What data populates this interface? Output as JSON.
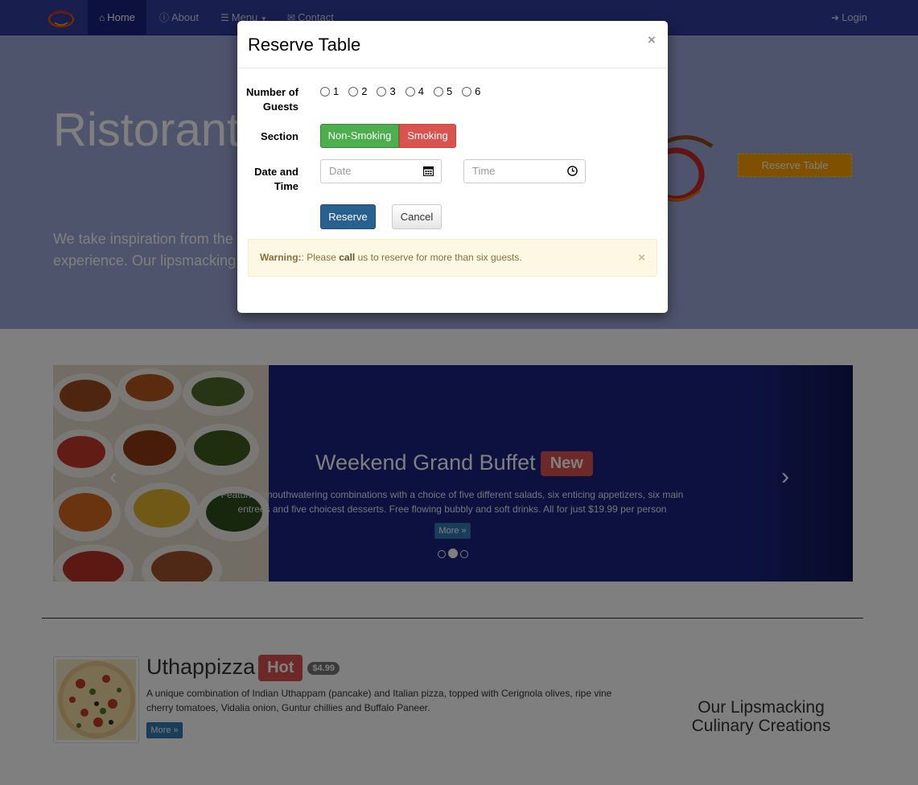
{
  "navbar": {
    "items": [
      {
        "label": "Home",
        "icon": "home-icon",
        "active": true
      },
      {
        "label": "About",
        "icon": "info-circle-icon"
      },
      {
        "label": "Menu",
        "icon": "list-icon",
        "dropdown": true
      },
      {
        "label": "Contact",
        "icon": "envelope-icon"
      }
    ],
    "login": "Login"
  },
  "jumbotron": {
    "title": "Ristorante",
    "text": "We take inspiration from the\nexperience. Our lipsmacking",
    "button": "Reserve Table"
  },
  "carousel": {
    "title": "Weekend Grand Buffet",
    "badge": "New",
    "text": "Featuring mouthwatering combinations with a choice of five different salads, six enticing appetizers, six main entrees and five choicest desserts. Free flowing bubbly and soft drinks. All for just $19.99 per person",
    "more": "More »",
    "active_slide": 2,
    "slide_count": 3
  },
  "dish": {
    "name": "Uthappizza",
    "badge": "Hot",
    "price": "$4.99",
    "description": "A unique combination of Indian Uthappam (pancake) and Italian pizza, topped with Cerignola olives, ripe vine cherry tomatoes, Vidalia onion, Guntur chillies and Buffalo Paneer.",
    "more": "More »"
  },
  "side_heading": "Our Lipsmacking Culinary Creations",
  "modal": {
    "title": "Reserve Table",
    "close": "×",
    "guests_label": "Number of Guests",
    "guest_options": [
      "1",
      "2",
      "3",
      "4",
      "5",
      "6"
    ],
    "section_label": "Section",
    "section_options": [
      "Non-Smoking",
      "Smoking"
    ],
    "datetime_label": "Date and Time",
    "date_placeholder": "Date",
    "time_placeholder": "Time",
    "reserve_button": "Reserve",
    "cancel_button": "Cancel",
    "alert": {
      "strong": "Warning:",
      "before": ": Please ",
      "call": "call",
      "after": " us to reserve for more than six guests.",
      "close": "×"
    }
  },
  "colors": {
    "navbar": "#303f9f",
    "jumbotron": "#9fa8da",
    "carousel": "#1a237e",
    "accent": "#ffa000",
    "danger": "#d9534f",
    "success": "#4cae4c",
    "primary": "#286090"
  }
}
